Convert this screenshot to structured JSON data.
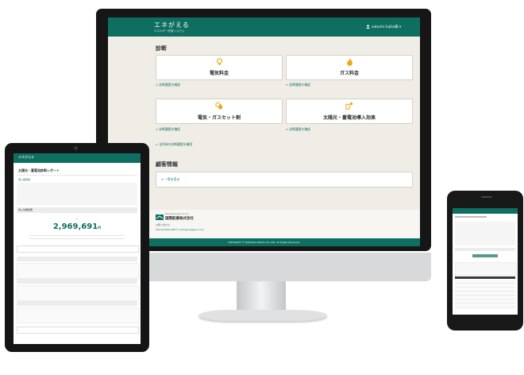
{
  "desktop": {
    "brand": "エネがえる",
    "brand_sub": "エネルギー診断システム",
    "user": "satoshi.fujita様 ▾",
    "section_diagnosis": "診断",
    "cards": [
      {
        "label": "電気料金",
        "icon": "lightbulb-icon",
        "link": "> 診断履歴を確認"
      },
      {
        "label": "ガス料金",
        "icon": "flame-icon",
        "link": "> 診断履歴を確認"
      },
      {
        "label": "電気・ガスセット割",
        "icon": "bulb-flame-icon",
        "link": "> 診断履歴を確認"
      },
      {
        "label": "太陽光・蓄電池導入効果",
        "icon": "solar-battery-icon",
        "link": "> 診断履歴を確認"
      }
    ],
    "all_history_link": "> 全所有の診断履歴を確認",
    "section_customer": "顧客情報",
    "customer_link": "> 一覧を見る",
    "company_name": "国際航業株式会社",
    "company_sub": "Kokusai Kogyo Group",
    "support": "お問い合わせ",
    "contact": "TEL 03-6361-6877  |  info@enegaeru.com",
    "copyright": "COPYRIGHT © KOKUSAI KOGYO CO.,LTD. All Rights Reserved."
  },
  "tablet": {
    "brand": "エネがえる",
    "report_title": "太陽光・蓄電池診断レポート",
    "basic_info_label": "導入前情報",
    "result_label": "導入効果結果",
    "result_amount": "2,969,691",
    "result_unit": "円"
  },
  "colors": {
    "primary": "#0e6f61",
    "accent": "#f2a516"
  }
}
